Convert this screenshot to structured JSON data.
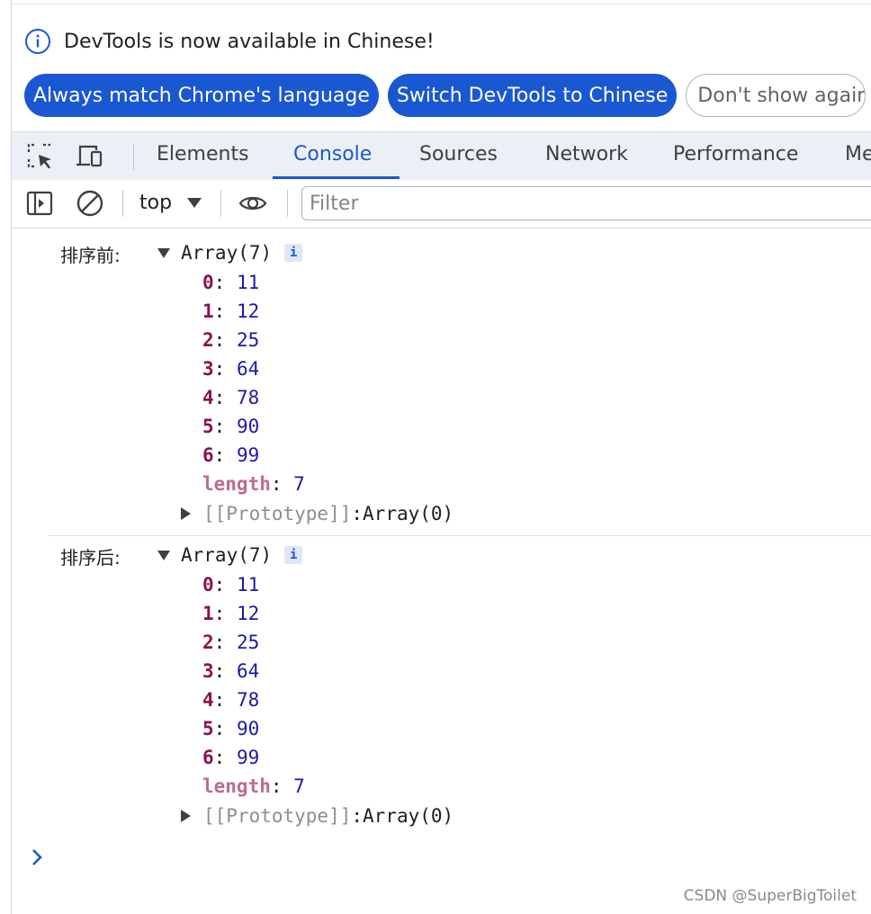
{
  "infobar": {
    "message": "DevTools is now available in Chinese!",
    "buttons": [
      "Always match Chrome's language",
      "Switch DevTools to Chinese",
      "Don't show again"
    ]
  },
  "tabs": [
    "Elements",
    "Console",
    "Sources",
    "Network",
    "Performance",
    "Me"
  ],
  "active_tab": "Console",
  "console_toolbar": {
    "context": "top",
    "filter_placeholder": "Filter"
  },
  "logs": [
    {
      "label": "排序前:",
      "title": "Array(7)",
      "badge": "i",
      "items": [
        {
          "key": "0",
          "value": "11"
        },
        {
          "key": "1",
          "value": "12"
        },
        {
          "key": "2",
          "value": "25"
        },
        {
          "key": "3",
          "value": "64"
        },
        {
          "key": "4",
          "value": "78"
        },
        {
          "key": "5",
          "value": "90"
        },
        {
          "key": "6",
          "value": "99"
        }
      ],
      "length_key": "length",
      "length_value": "7",
      "proto_key": "[[Prototype]]",
      "proto_value": "Array(0)"
    },
    {
      "label": "排序后:",
      "title": "Array(7)",
      "badge": "i",
      "items": [
        {
          "key": "0",
          "value": "11"
        },
        {
          "key": "1",
          "value": "12"
        },
        {
          "key": "2",
          "value": "25"
        },
        {
          "key": "3",
          "value": "64"
        },
        {
          "key": "4",
          "value": "78"
        },
        {
          "key": "5",
          "value": "90"
        },
        {
          "key": "6",
          "value": "99"
        }
      ],
      "length_key": "length",
      "length_value": "7",
      "proto_key": "[[Prototype]]",
      "proto_value": "Array(0)"
    }
  ],
  "watermark": "CSDN @SuperBigToilet",
  "colors": {
    "accent": "#1a57d2",
    "prop_key": "#881350",
    "prop_value": "#1a1aa6"
  }
}
